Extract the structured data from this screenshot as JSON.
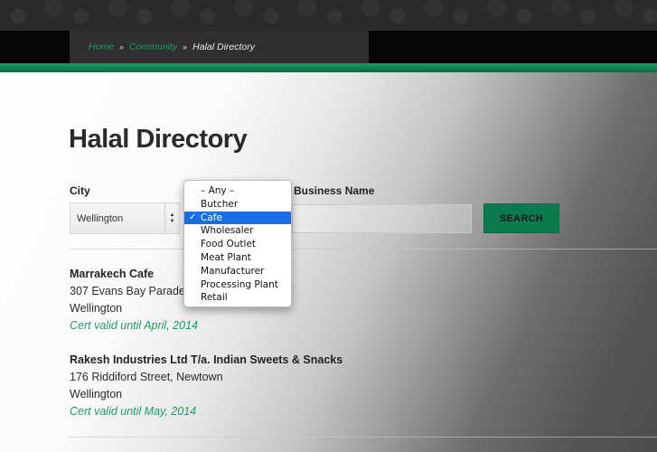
{
  "breadcrumb": {
    "items": [
      {
        "label": "Home"
      },
      {
        "label": "Community"
      },
      {
        "label": "Halal Directory"
      }
    ],
    "separator": "»"
  },
  "page": {
    "title": "Halal Directory"
  },
  "filters": {
    "city_label": "City",
    "city_value": "Wellington",
    "business_name_label": "Business Name",
    "business_name_value": "",
    "search_button": "SEARCH",
    "type_options": [
      "– Any –",
      "Butcher",
      "Cafe",
      "Wholesaler",
      "Food Outlet",
      "Meat Plant",
      "Manufacturer",
      "Processing Plant",
      "Retail"
    ],
    "type_selected": "Cafe",
    "check_mark": "✓"
  },
  "listings": [
    {
      "name": "Marrakech Cafe",
      "address": "307 Evans Bay Parade, Ha",
      "city": "Wellington",
      "cert": "Cert valid until April, 2014"
    },
    {
      "name": "Rakesh Industries Ltd T/a. Indian Sweets & Snacks",
      "address": "176 Riddiford Street, Newtown",
      "city": "Wellington",
      "cert": "Cert valid until May, 2014"
    }
  ],
  "colors": {
    "accent_green": "#1e9a66",
    "button_green": "#0c7a4f",
    "dropdown_highlight": "#1a6fe0"
  }
}
